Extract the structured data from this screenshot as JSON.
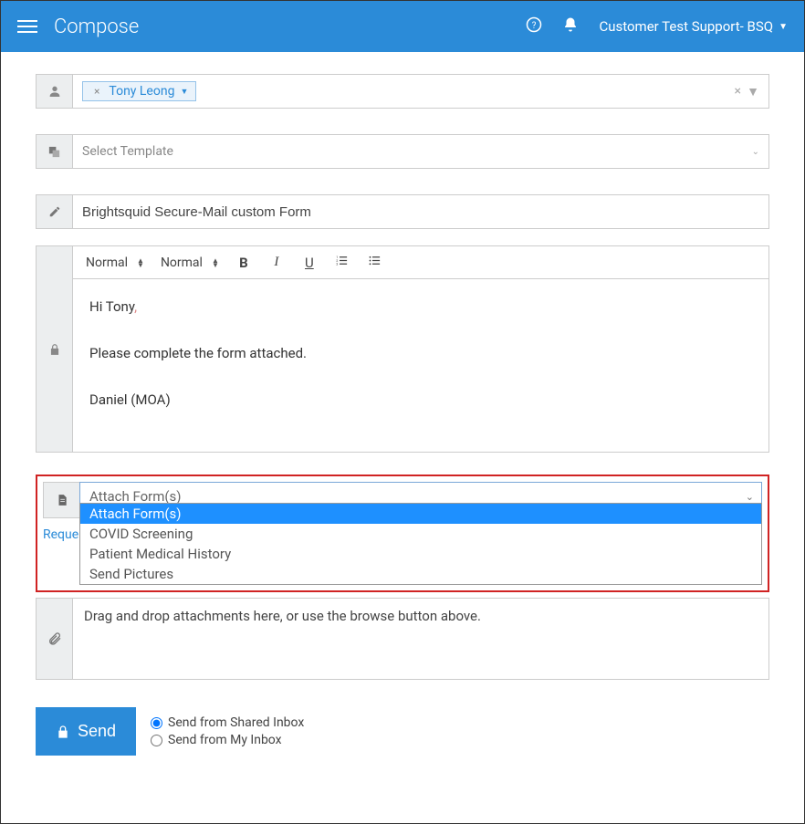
{
  "header": {
    "title": "Compose",
    "user_label": "Customer Test Support- BSQ"
  },
  "recipient": {
    "name": "Tony Leong"
  },
  "template": {
    "placeholder": "Select Template"
  },
  "subject": {
    "value": "Brightsquid Secure-Mail custom Form"
  },
  "editor": {
    "toolbar": {
      "style1": "Normal",
      "style2": "Normal"
    },
    "body": {
      "greeting_prefix": "Hi Tony",
      "greeting_suffix": ",",
      "line2": "Please complete the form attached.",
      "signature": "Daniel (MOA)"
    }
  },
  "attach_forms": {
    "selected": "Attach Form(s)",
    "options": [
      "Attach Form(s)",
      "COVID Screening",
      "Patient Medical History",
      "Send Pictures"
    ]
  },
  "request_link": "Reque",
  "dropzone": {
    "text": "Drag and drop attachments here, or use the browse button above."
  },
  "send": {
    "label": "Send",
    "radio1": "Send from Shared Inbox",
    "radio2": "Send from My Inbox"
  }
}
